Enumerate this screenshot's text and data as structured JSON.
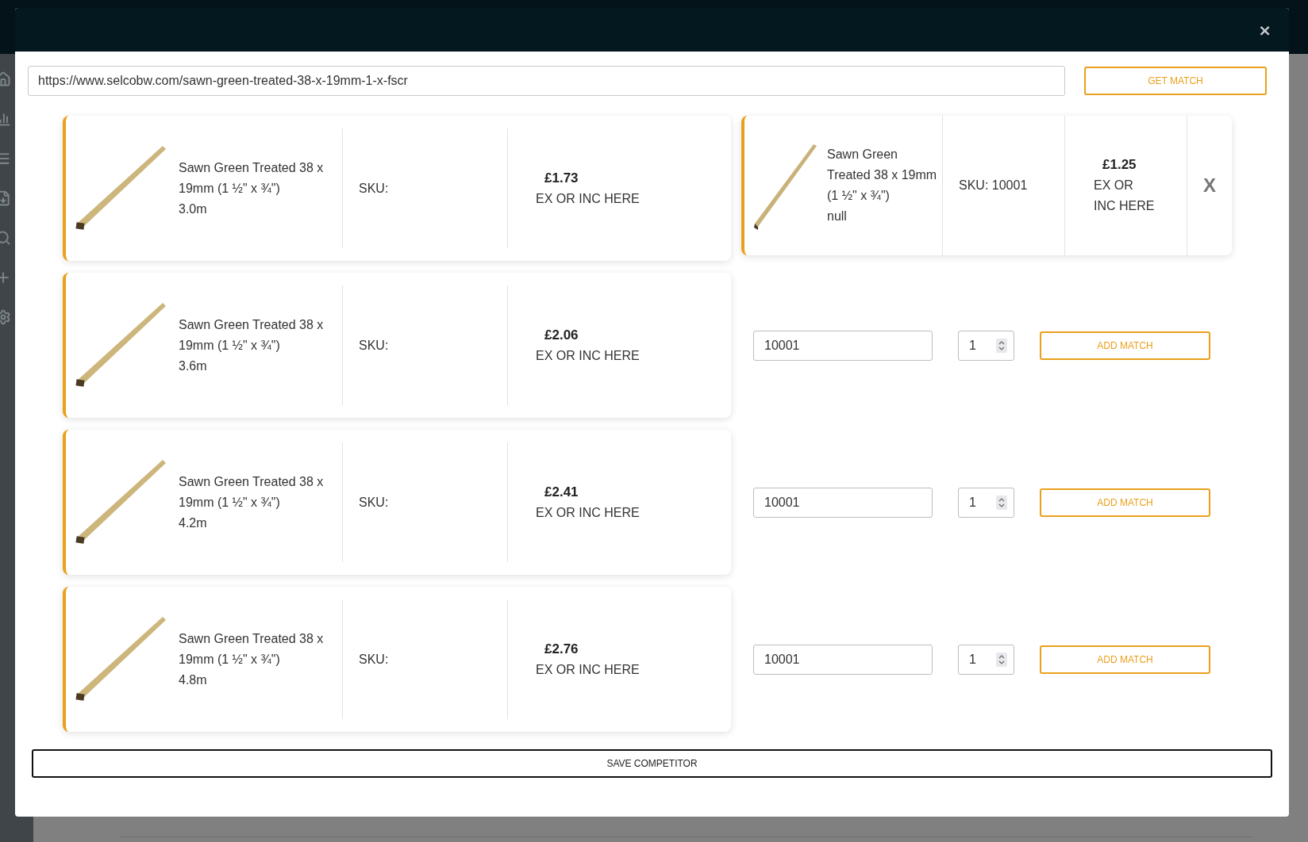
{
  "modal": {
    "close": "×",
    "url": {
      "value": "https://www.selcobw.com/sawn-green-treated-38-x-19mm-1-x-fscr"
    },
    "get_match_button": "GET MATCH",
    "rows": [
      {
        "product": {
          "name": "Sawn Green Treated 38 x 19mm (1 ½\" x ¾\")",
          "length": "3.0m",
          "sku": "SKU:",
          "price": "£1.73",
          "price_note": "EX OR INC HERE"
        },
        "match": {
          "kind": "card",
          "name": "Sawn Green Treated 38 x 19mm (1 ½\" x ¾\")",
          "length": "null",
          "sku": "SKU: 10001",
          "price": "£1.25",
          "price_note": "EX OR INC HERE",
          "remove": "X"
        }
      },
      {
        "product": {
          "name": "Sawn Green Treated 38 x 19mm (1 ½\" x ¾\")",
          "length": "3.6m",
          "sku": "SKU:",
          "price": "£2.06",
          "price_note": "EX OR INC HERE"
        },
        "match": {
          "kind": "form",
          "sku_value": "10001",
          "quantity": "1",
          "button": "ADD MATCH"
        }
      },
      {
        "product": {
          "name": "Sawn Green Treated 38 x 19mm (1 ½\" x ¾\")",
          "length": "4.2m",
          "sku": "SKU:",
          "price": "£2.41",
          "price_note": "EX OR INC HERE"
        },
        "match": {
          "kind": "form",
          "sku_value": "10001",
          "quantity": "1",
          "button": "ADD MATCH"
        }
      },
      {
        "product": {
          "name": "Sawn Green Treated 38 x 19mm (1 ½\" x ¾\")",
          "length": "4.8m",
          "sku": "SKU:",
          "price": "£2.76",
          "price_note": "EX OR INC HERE"
        },
        "match": {
          "kind": "form",
          "sku_value": "10001",
          "quantity": "1",
          "button": "ADD MATCH"
        }
      }
    ],
    "save_button": "SAVE COMPETITOR"
  }
}
